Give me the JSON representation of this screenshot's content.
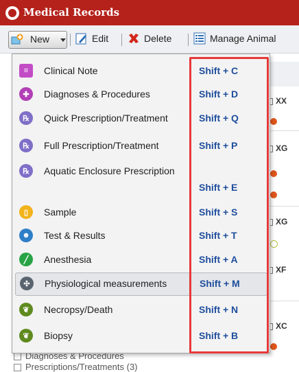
{
  "window": {
    "title": "Medical Records"
  },
  "toolbar": {
    "new_label": "New",
    "edit_label": "Edit",
    "delete_label": "Delete",
    "manage_label": "Manage Animal"
  },
  "background": {
    "column_cells": [
      "XX",
      "XG",
      "XG",
      "XF",
      "XC"
    ],
    "tree_items": [
      "Diagnoses & Procedures",
      "Prescriptions/Treatments (3)"
    ]
  },
  "menu": {
    "items": [
      {
        "label": "Clinical Note",
        "shortcut": "Shift + C",
        "icon": "clinical-note-icon",
        "color": "#c24cc6"
      },
      {
        "label": "Diagnoses & Procedures",
        "shortcut": "Shift + D",
        "icon": "diagnoses-icon",
        "color": "#b23fb6"
      },
      {
        "label": "Quick Prescription/Treatment",
        "shortcut": "Shift + Q",
        "icon": "rx-icon",
        "color": "#7f6fc8"
      },
      {
        "label": "Full Prescription/Treatment",
        "shortcut": "Shift + P",
        "icon": "rx-icon",
        "color": "#7f6fc8"
      },
      {
        "label": "Aquatic Enclosure Prescription",
        "shortcut": "Shift + E",
        "icon": "rx-icon",
        "color": "#7f6fc8"
      },
      {
        "label": "Sample",
        "shortcut": "Shift + S",
        "icon": "sample-icon",
        "color": "#f2b31b"
      },
      {
        "label": "Test & Results",
        "shortcut": "Shift + T",
        "icon": "test-results-icon",
        "color": "#2e7fc7"
      },
      {
        "label": "Anesthesia",
        "shortcut": "Shift + A",
        "icon": "anesthesia-icon",
        "color": "#27a346"
      },
      {
        "label": "Physiological measurements",
        "shortcut": "Shift + M",
        "icon": "physiological-icon",
        "color": "#5a6470"
      },
      {
        "label": "Necropsy/Death",
        "shortcut": "Shift + N",
        "icon": "necropsy-icon",
        "color": "#5f8a1f"
      },
      {
        "label": "Biopsy",
        "shortcut": "Shift + B",
        "icon": "biopsy-icon",
        "color": "#5f8a1f"
      }
    ],
    "highlighted_index": 8
  },
  "colors": {
    "titlebar": "#b5221b",
    "shortcut_text": "#1f4e9c",
    "highlight_box": "#e6393a",
    "status_dot_red": "#e0561c"
  }
}
